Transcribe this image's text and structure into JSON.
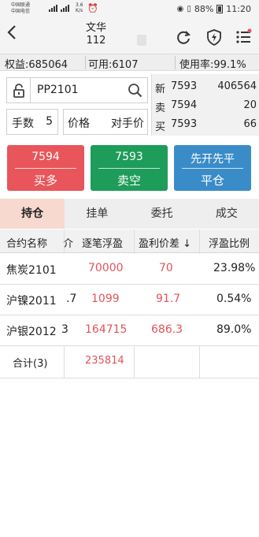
{
  "status_bar": {
    "carrier1": "中国联通",
    "carrier2": "中国电信",
    "net_speed_value": "3.6",
    "net_speed_unit": "K/s",
    "battery": "88%",
    "time": "11:20"
  },
  "header": {
    "title": "文华",
    "subtitle": "112"
  },
  "account": {
    "equity": "权益:685064",
    "available": "可用:6107",
    "usage": "使用率:99.1%"
  },
  "order_form": {
    "contract": "PP2101",
    "qty_label": "手数",
    "qty_value": "5",
    "price_label": "价格",
    "price_value": "对手价"
  },
  "quote": {
    "last_label": "新",
    "last_price": "7593",
    "last_vol": "406564",
    "ask_label": "卖",
    "ask_price": "7594",
    "ask_vol": "20",
    "bid_label": "买",
    "bid_price": "7593",
    "bid_vol": "66"
  },
  "buttons": {
    "buy_price": "7594",
    "buy_label": "买多",
    "sell_price": "7593",
    "sell_label": "卖空",
    "close_top": "先开先平",
    "close_label": "平仓"
  },
  "tabs": [
    "持仓",
    "挂单",
    "委托",
    "成交"
  ],
  "table": {
    "headers": [
      "合约名称",
      "介",
      "逐笔浮盈",
      "盈利价差 ↓",
      "浮盈比例"
    ],
    "rows": [
      {
        "name": "焦炭2101",
        "partial": "",
        "float_pnl": "70000",
        "price_diff": "70",
        "ratio": "23.98%"
      },
      {
        "name": "沪镍2011",
        "partial": ".7",
        "float_pnl": "1099",
        "price_diff": "91.7",
        "ratio": "0.54%"
      },
      {
        "name": "沪银2012",
        "partial": "3",
        "float_pnl": "164715",
        "price_diff": "686.3",
        "ratio": "89.0%"
      }
    ],
    "total_label": "合计(3)",
    "total_value": "235814"
  },
  "colors": {
    "buy": "#e8555a",
    "sell": "#1e9c5a",
    "close": "#3a8cc8",
    "active_tab": "#f7d9cf",
    "profit_text": "#e0555a"
  }
}
